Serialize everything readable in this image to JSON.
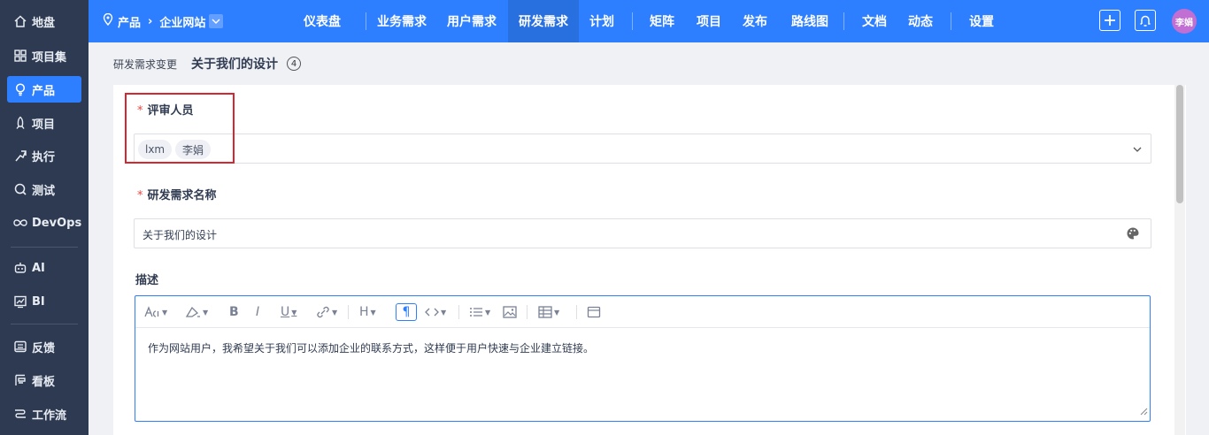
{
  "sidebar": {
    "items": [
      {
        "label": "地盘",
        "icon": "home-icon"
      },
      {
        "label": "项目集",
        "icon": "grid-icon"
      },
      {
        "label": "产品",
        "icon": "bulb-icon"
      },
      {
        "label": "项目",
        "icon": "rocket-icon"
      },
      {
        "label": "执行",
        "icon": "run-icon"
      },
      {
        "label": "测试",
        "icon": "test-icon"
      },
      {
        "label": "DevOps",
        "icon": "infinity-icon"
      },
      {
        "label": "AI",
        "icon": "robot-icon"
      },
      {
        "label": "BI",
        "icon": "chart-icon"
      },
      {
        "label": "反馈",
        "icon": "feedback-icon"
      },
      {
        "label": "看板",
        "icon": "board-icon"
      },
      {
        "label": "工作流",
        "icon": "workflow-icon"
      }
    ],
    "active": "产品"
  },
  "topbar": {
    "breadcrumb": {
      "product": "产品",
      "current": "企业网站"
    },
    "nav": [
      "仪表盘",
      "业务需求",
      "用户需求",
      "研发需求",
      "计划",
      "矩阵",
      "项目",
      "发布",
      "路线图",
      "文档",
      "动态",
      "设置"
    ],
    "active_nav": "研发需求",
    "avatar_text": "李娟"
  },
  "page": {
    "type_label": "研发需求变更",
    "title": "关于我们的设计",
    "count": "4"
  },
  "form": {
    "reviewers": {
      "label": "评审人员",
      "required_mark": "*",
      "tags": [
        "lxm",
        "李娟"
      ]
    },
    "name": {
      "label": "研发需求名称",
      "required_mark": "*",
      "value": "关于我们的设计"
    },
    "description": {
      "label": "描述",
      "value": "作为网站用户，我希望关于我们可以添加企业的联系方式，这样便于用户快速与企业建立链接。"
    }
  },
  "colors": {
    "primary": "#2e7fff",
    "sidebar": "#2e3a51",
    "required": "#f1453d",
    "highlight": "#d7262f"
  }
}
